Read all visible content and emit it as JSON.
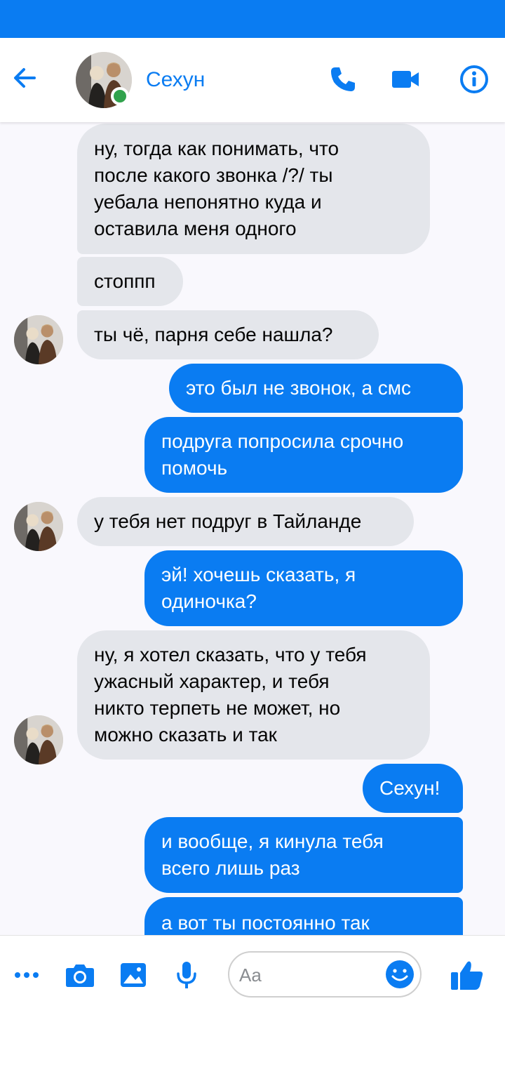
{
  "colors": {
    "accent": "#0a7cf2",
    "incoming_bubble": "#e4e6eb",
    "online": "#31a24c"
  },
  "header": {
    "contact_name": "Сехун",
    "icons": [
      "back-arrow-icon",
      "phone-icon",
      "video-camera-icon",
      "info-icon"
    ]
  },
  "messages": [
    {
      "direction": "in",
      "lines": [
        "ну, тогда как понимать, что",
        "после какого звонка /?/ ты",
        "уебала непонятно куда и",
        "оставила меня одного"
      ]
    },
    {
      "direction": "in",
      "lines": [
        "стоппп"
      ]
    },
    {
      "direction": "in",
      "lines": [
        "ты чё, парня себе нашла?"
      ]
    },
    {
      "direction": "out",
      "lines": [
        "это был не звонок, а смс"
      ]
    },
    {
      "direction": "out",
      "lines": [
        "подруга попросила срочно",
        "помочь"
      ]
    },
    {
      "direction": "in",
      "lines": [
        "у тебя нет подруг в Тайланде"
      ]
    },
    {
      "direction": "out",
      "lines": [
        "эй! хочешь сказать, я",
        "одиночка?"
      ]
    },
    {
      "direction": "in",
      "lines": [
        "ну, я хотел сказать, что у тебя",
        "ужасный характер, и тебя",
        "никто терпеть не может, но",
        "можно сказать и так"
      ]
    },
    {
      "direction": "out",
      "lines": [
        "Сехун!"
      ]
    },
    {
      "direction": "out",
      "lines": [
        "и вообще, я кинула тебя",
        "всего лишь раз"
      ]
    },
    {
      "direction": "out",
      "lines": [
        "а вот ты постоянно так"
      ]
    }
  ],
  "composer": {
    "placeholder": "Aa",
    "icons": [
      "more-dots-icon",
      "camera-icon",
      "gallery-image-icon",
      "microphone-icon",
      "emoji-icon",
      "like-thumb-icon"
    ]
  }
}
